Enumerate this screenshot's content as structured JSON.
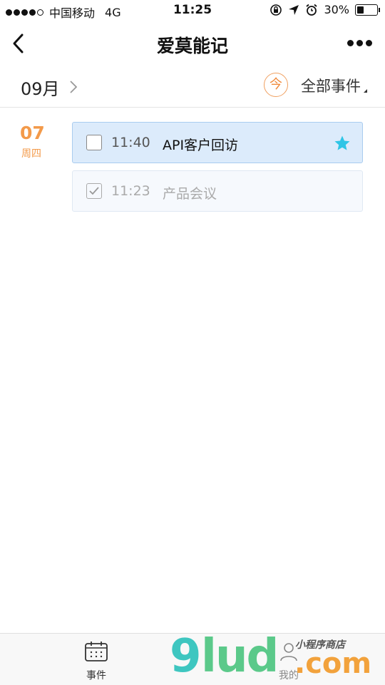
{
  "status_bar": {
    "carrier": "中国移动",
    "network": "4G",
    "time": "11:25",
    "battery": "30%"
  },
  "nav": {
    "title": "爱莫能记"
  },
  "month_bar": {
    "month": "09月",
    "today_label": "今",
    "filter_label": "全部事件"
  },
  "day": {
    "date": "07",
    "weekday": "周四"
  },
  "events": [
    {
      "time": "11:40",
      "title": "API客户回访",
      "done": false,
      "starred": true
    },
    {
      "time": "11:23",
      "title": "产品会议",
      "done": true,
      "starred": false
    }
  ],
  "tab_bar": {
    "tabs": [
      {
        "label": "事件",
        "icon": "calendar-icon"
      },
      {
        "label": "我的",
        "icon": "user-icon"
      }
    ]
  },
  "watermark": {
    "brand": "9lud.com",
    "tagline": "小程序商店"
  },
  "colors": {
    "accent_orange": "#f39a4a",
    "card_blue": "#dcebfb",
    "star_cyan": "#2ec5e6",
    "watermark_teal": "#3ec6c0",
    "watermark_green": "#5bc98a",
    "watermark_orange": "#f2a23c"
  }
}
